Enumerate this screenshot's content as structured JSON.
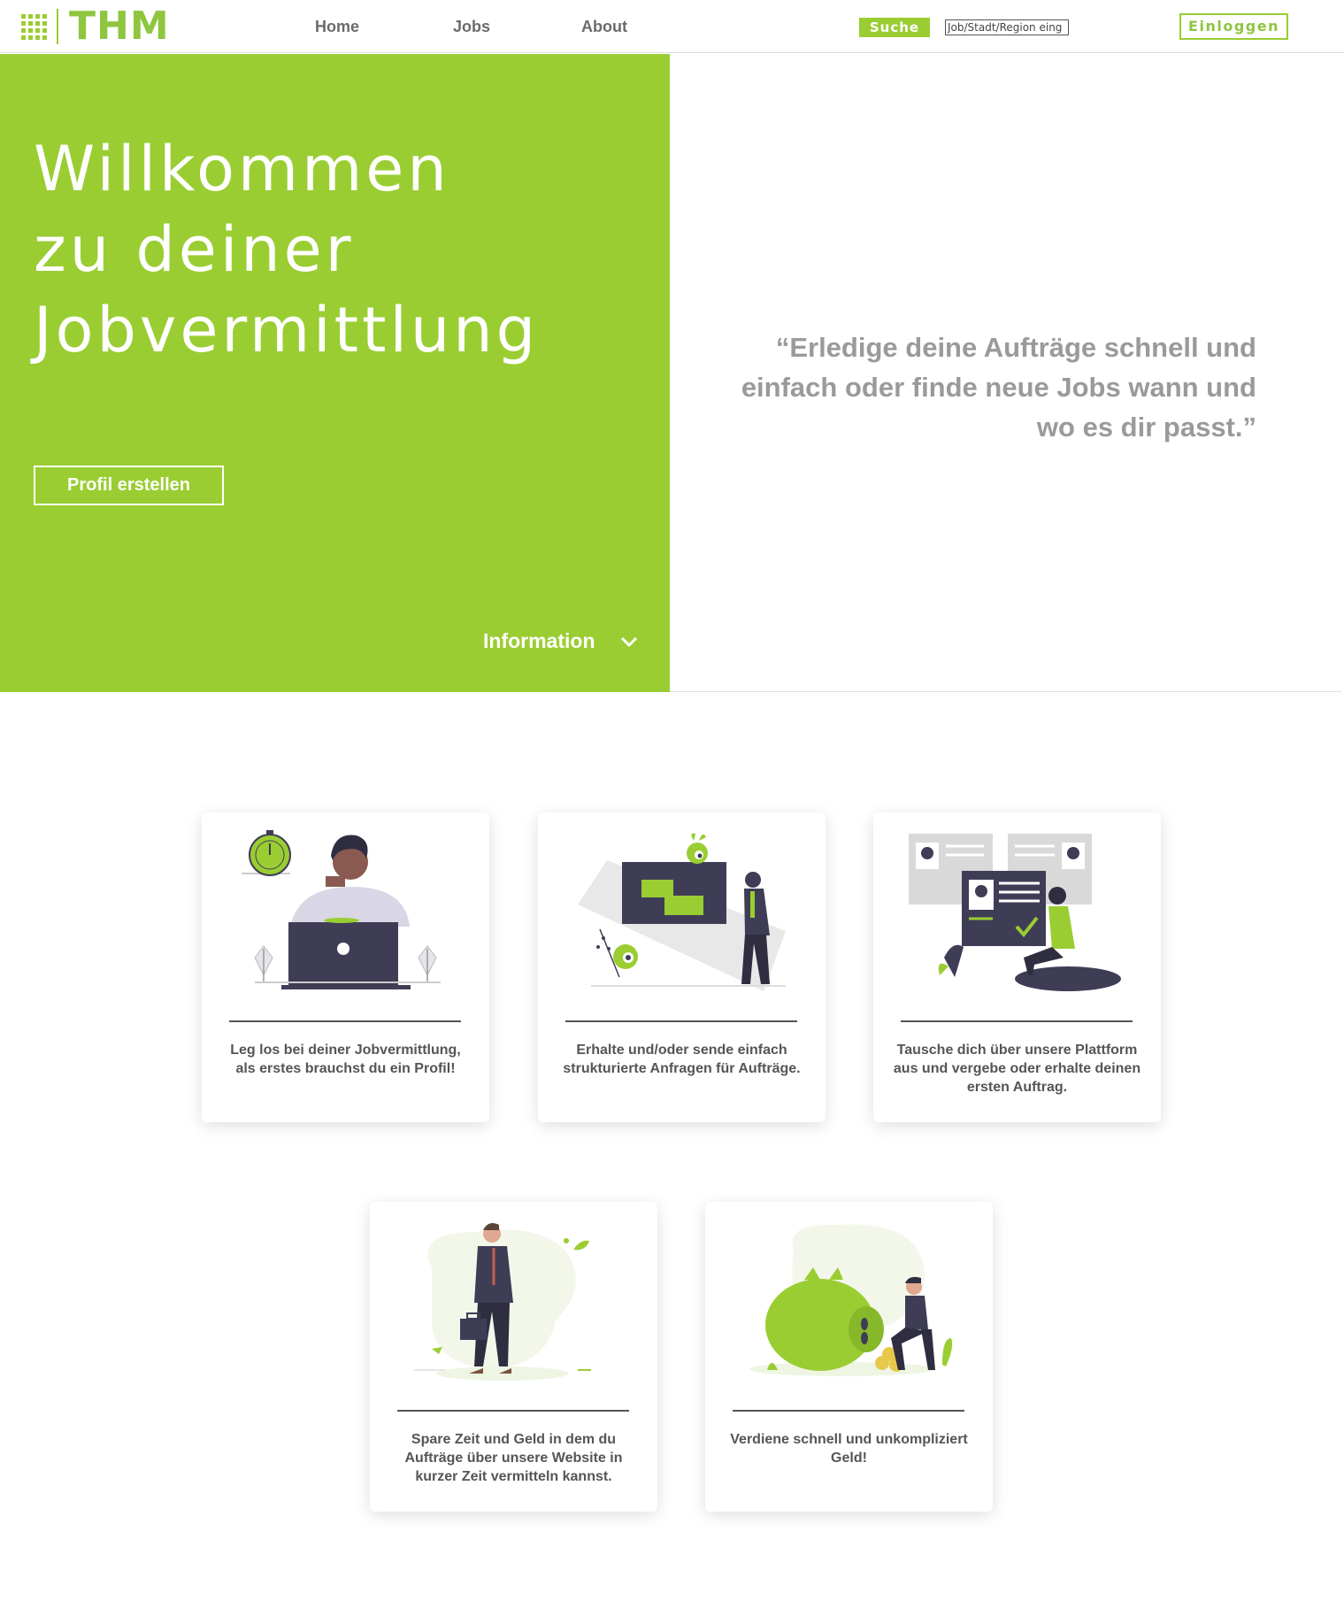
{
  "header": {
    "logo_text": "THM",
    "nav": [
      "Home",
      "Jobs",
      "About"
    ],
    "search_label": "Suche",
    "search_value": "Job/Stadt/Region eing",
    "login_label": "Einloggen"
  },
  "hero": {
    "title": "Willkommen\nzu deiner\nJobvermittlung",
    "profile_button": "Profil erstellen",
    "info_link": "Information",
    "quote": "“Erledige deine Aufträge schnell und einfach oder finde neue Jobs wann und wo es dir passt.”"
  },
  "cards": [
    "Leg los bei deiner Jobvermittlung, als erstes brauchst du ein Profil!",
    "Erhalte und/oder sende einfach strukturierte Anfragen für Aufträge.",
    "Tausche dich über unsere Plattform aus und vergebe oder erhalte deinen ersten Auftrag.",
    "Spare Zeit und Geld in dem du Aufträge über unsere Website in kurzer Zeit vermitteln kannst.",
    "Verdiene schnell und unkompliziert Geld!"
  ],
  "colors": {
    "accent": "#9acd32",
    "dark": "#3f3d56",
    "text": "#555555",
    "quote": "#9a9a9a"
  },
  "icons": [
    "chevron-down-icon"
  ]
}
